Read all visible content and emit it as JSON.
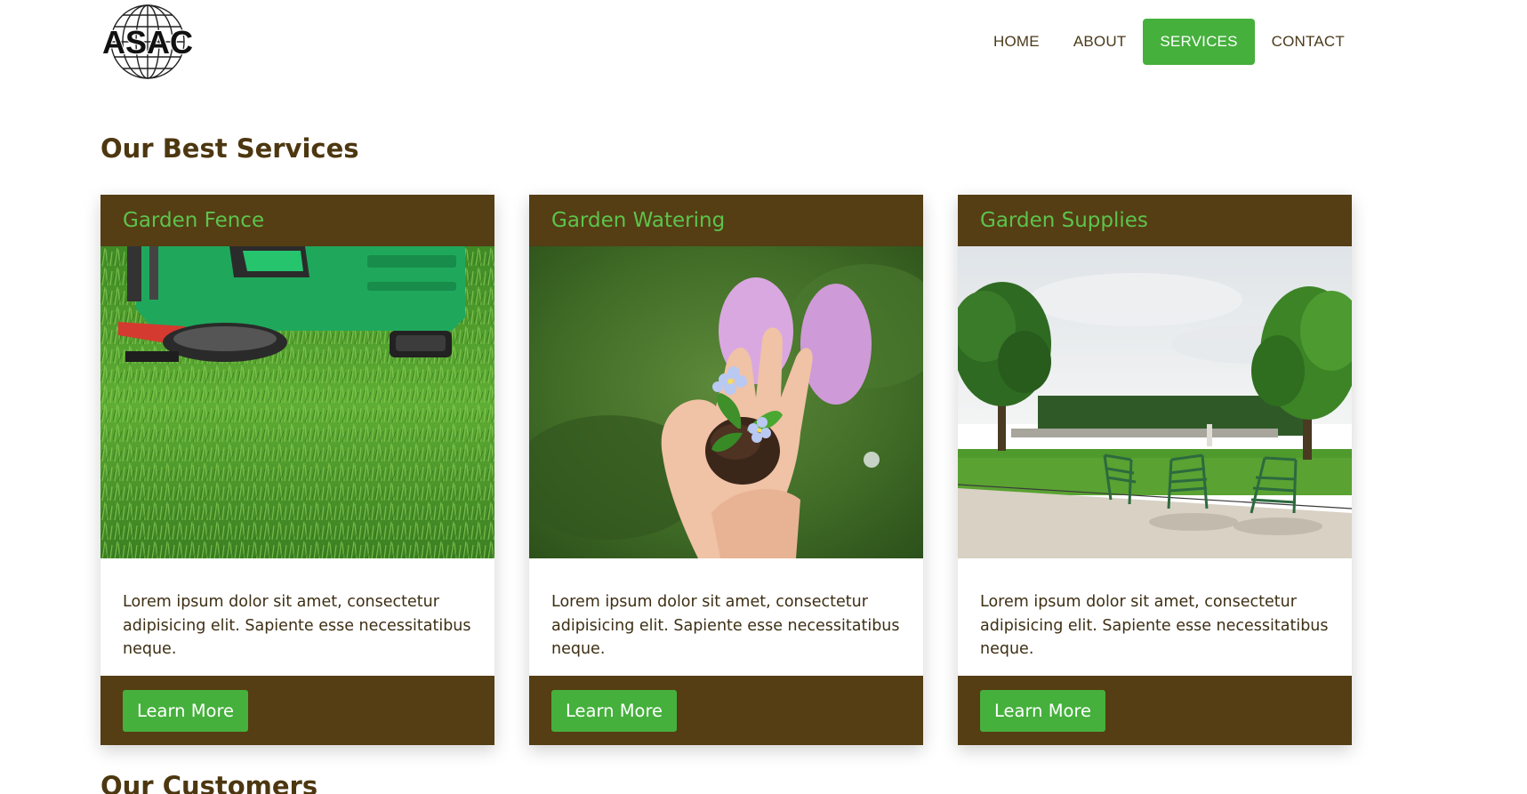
{
  "logo": {
    "text": "ASAC"
  },
  "nav": {
    "items": [
      {
        "label": "HOME",
        "active": false
      },
      {
        "label": "ABOUT",
        "active": false
      },
      {
        "label": "SERVICES",
        "active": true
      },
      {
        "label": "CONTACT",
        "active": false
      }
    ]
  },
  "sections": {
    "services_title": "Our Best Services",
    "customers_title": "Our Customers"
  },
  "cards": [
    {
      "title": "Garden Fence",
      "image": "lawn-mower-on-grass",
      "text": "Lorem ipsum dolor sit amet, consectetur adipisicing elit. Sapiente esse necessitatibus neque.",
      "button": "Learn More"
    },
    {
      "title": "Garden Watering",
      "image": "hands-holding-seedling",
      "text": "Lorem ipsum dolor sit amet, consectetur adipisicing elit. Sapiente esse necessitatibus neque.",
      "button": "Learn More"
    },
    {
      "title": "Garden Supplies",
      "image": "park-with-chairs",
      "text": "Lorem ipsum dolor sit amet, consectetur adipisicing elit. Sapiente esse necessitatibus neque.",
      "button": "Learn More"
    }
  ],
  "colors": {
    "brand_green": "#45b03c",
    "brand_brown": "#553d14",
    "title_green": "#5cc44c",
    "heading_brown": "#4d3710"
  }
}
